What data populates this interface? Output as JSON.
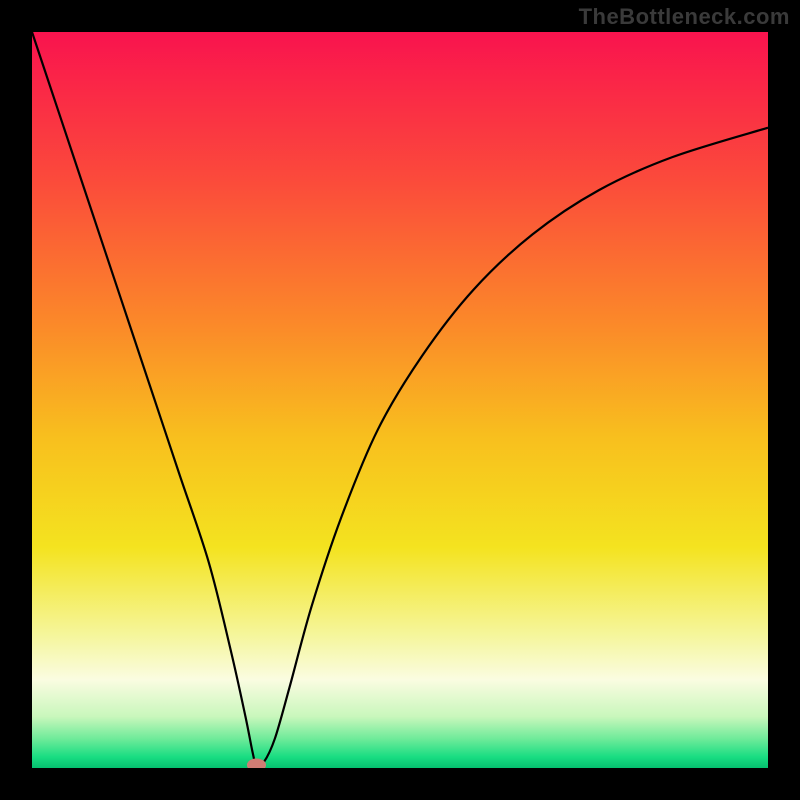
{
  "watermark": "TheBottleneck.com",
  "chart_data": {
    "type": "line",
    "title": "",
    "xlabel": "",
    "ylabel": "",
    "xlim": [
      0,
      100
    ],
    "ylim": [
      0,
      100
    ],
    "axes_visible": false,
    "grid": false,
    "background_gradient": {
      "stops": [
        {
          "offset": 0.0,
          "color": "#f9134e"
        },
        {
          "offset": 0.2,
          "color": "#fb4a3b"
        },
        {
          "offset": 0.4,
          "color": "#fb8a29"
        },
        {
          "offset": 0.55,
          "color": "#f8bf1e"
        },
        {
          "offset": 0.7,
          "color": "#f4e31f"
        },
        {
          "offset": 0.82,
          "color": "#f5f69c"
        },
        {
          "offset": 0.88,
          "color": "#fafce1"
        },
        {
          "offset": 0.93,
          "color": "#c9f7bc"
        },
        {
          "offset": 0.96,
          "color": "#70eb9a"
        },
        {
          "offset": 0.985,
          "color": "#19dd82"
        },
        {
          "offset": 1.0,
          "color": "#05c06f"
        }
      ]
    },
    "curve": {
      "x": [
        0,
        4,
        8,
        12,
        16,
        20,
        24,
        27,
        29,
        30,
        30.5,
        31.5,
        33,
        35,
        38,
        42,
        47,
        53,
        60,
        68,
        77,
        87,
        100
      ],
      "y": [
        100,
        88,
        76,
        64,
        52,
        40,
        28,
        16,
        7,
        2,
        0.4,
        0.8,
        4,
        11,
        22,
        34,
        46,
        56,
        65,
        72.5,
        78.5,
        83,
        87
      ]
    },
    "marker": {
      "x": 30.5,
      "y": 0.4,
      "color": "#cf7c74",
      "rx": 1.3,
      "ry": 0.9
    }
  }
}
